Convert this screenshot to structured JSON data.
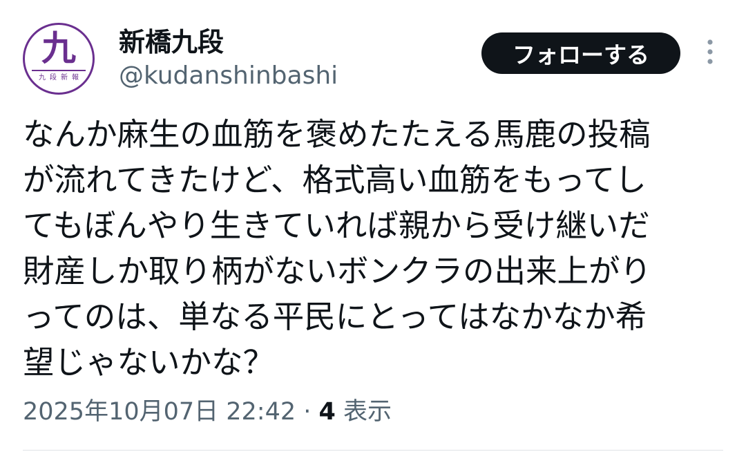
{
  "account": {
    "display_name": "新橋九段",
    "handle": "@kudanshinbashi",
    "avatar_kanji": "九",
    "avatar_subtext": "九段新報"
  },
  "actions": {
    "follow_label": "フォローする",
    "more_icon": "more-vertical-icon"
  },
  "tweet": {
    "text": "なんか麻生の血筋を褒めたたえる馬鹿の投稿\nが流れてきたけど、格式高い血筋をもってし\nてもぼんやり生きていれば親から受け継いだ\n財産しか取り柄がないボンクラの出来上がり\nってのは、単なる平民にとってはなかなか希\n望じゃないかな？",
    "timestamp": "2025年10月07日 22:42",
    "separator": " · ",
    "views_count": "4",
    "views_label": " 表示"
  },
  "colors": {
    "text_primary": "#0f1419",
    "text_secondary": "#536471",
    "avatar_accent": "#6a2f8f",
    "button_bg": "#0f1419"
  }
}
